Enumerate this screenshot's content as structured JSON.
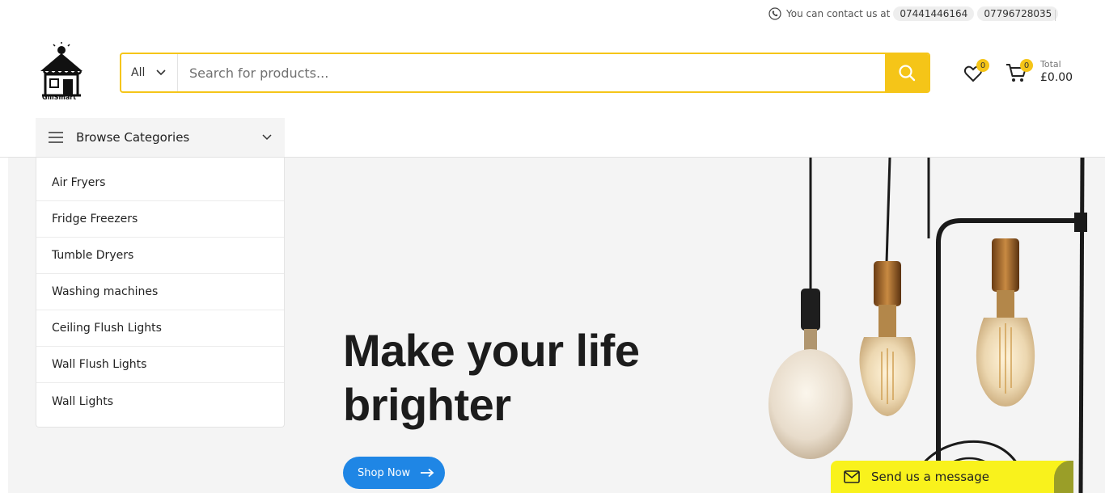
{
  "topbar": {
    "contact_text": "You can contact us at",
    "phone_1": "07441446164",
    "phone_2": "07796728035"
  },
  "header": {
    "logo_text": "GillSmart",
    "search": {
      "category": "All",
      "placeholder": "Search for products..."
    },
    "wishlist_count": "0",
    "cart_count": "0",
    "total_label": "Total",
    "total_value": "£0.00"
  },
  "categories": {
    "title": "Browse Categories",
    "items": [
      {
        "label": "Air Fryers"
      },
      {
        "label": "Fridge Freezers"
      },
      {
        "label": "Tumble Dryers"
      },
      {
        "label": "Washing machines"
      },
      {
        "label": "Ceiling Flush Lights"
      },
      {
        "label": "Wall Flush Lights"
      },
      {
        "label": "Wall Lights"
      }
    ]
  },
  "hero": {
    "title_line_1": "Make your life",
    "title_line_2": "brighter",
    "button_label": "Shop Now"
  },
  "chat": {
    "label": "Send us a message"
  },
  "colors": {
    "accent_yellow": "#f5c518",
    "button_blue": "#1f86e5",
    "chat_yellow": "#f9f21c",
    "hero_bg": "#f4f4f4"
  }
}
